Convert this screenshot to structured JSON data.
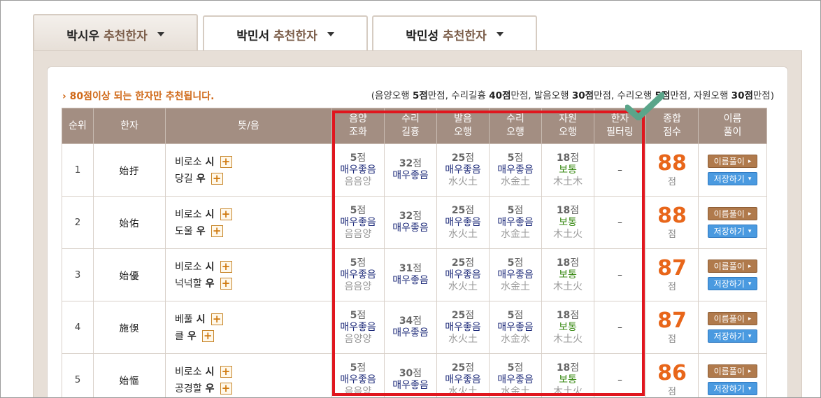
{
  "tabs": [
    {
      "name": "박시우",
      "label": "추천한자"
    },
    {
      "name": "박민서",
      "label": "추천한자"
    },
    {
      "name": "박민성",
      "label": "추천한자"
    }
  ],
  "notice": "› 80점이상 되는 한자만 추천됩니다.",
  "score_info": {
    "p0": "(음양오행 ",
    "b0": "5점",
    "p1": "만점, 수리길흉 ",
    "b1": "40점",
    "p2": "만점, 발음오행 ",
    "b2": "30점",
    "p3": "만점, 수리오행 ",
    "b3": "5점",
    "p4": "만점, 자원오행 ",
    "b4": "30점",
    "p5": "만점)"
  },
  "headers": {
    "rank": "순위",
    "hanja": "한자",
    "meaning": "뜻/음",
    "yinyang": [
      "음양",
      "조화"
    ],
    "suri_gh": [
      "수리",
      "길흉"
    ],
    "bareum": [
      "발음",
      "오행"
    ],
    "suri_oh": [
      "수리",
      "오행"
    ],
    "jawon": [
      "자원",
      "오행"
    ],
    "filter": [
      "한자",
      "필터링"
    ],
    "total": [
      "종합",
      "점수"
    ],
    "interp": [
      "이름",
      "풀이"
    ]
  },
  "buttons": {
    "interp": "이름풀이",
    "save": "저장하기"
  },
  "rows": [
    {
      "rank": "1",
      "hanja": "始扜",
      "m1": {
        "mean": "비로소",
        "sound": "시"
      },
      "m2": {
        "mean": "당길",
        "sound": "우"
      },
      "yy": {
        "num": "5",
        "unit": "점",
        "lvl": "매우좋음",
        "sub": "음음양"
      },
      "sg": {
        "num": "32",
        "unit": "점",
        "lvl": "매우좋음",
        "sub": ""
      },
      "br": {
        "num": "25",
        "unit": "점",
        "lvl": "매우좋음",
        "sub": "水火土"
      },
      "so": {
        "num": "5",
        "unit": "점",
        "lvl": "매우좋음",
        "sub": "水金土"
      },
      "jw": {
        "num": "18",
        "unit": "점",
        "lvl": "보통",
        "sub": "木土木"
      },
      "filter": "–",
      "total": "88",
      "total_unit": "점"
    },
    {
      "rank": "2",
      "hanja": "始佑",
      "m1": {
        "mean": "비로소",
        "sound": "시"
      },
      "m2": {
        "mean": "도울",
        "sound": "우"
      },
      "yy": {
        "num": "5",
        "unit": "점",
        "lvl": "매우좋음",
        "sub": "음음양"
      },
      "sg": {
        "num": "32",
        "unit": "점",
        "lvl": "매우좋음",
        "sub": ""
      },
      "br": {
        "num": "25",
        "unit": "점",
        "lvl": "매우좋음",
        "sub": "水火土"
      },
      "so": {
        "num": "5",
        "unit": "점",
        "lvl": "매우좋음",
        "sub": "水金土"
      },
      "jw": {
        "num": "18",
        "unit": "점",
        "lvl": "보통",
        "sub": "木土火"
      },
      "filter": "–",
      "total": "88",
      "total_unit": "점"
    },
    {
      "rank": "3",
      "hanja": "始優",
      "m1": {
        "mean": "비로소",
        "sound": "시"
      },
      "m2": {
        "mean": "넉넉할",
        "sound": "우"
      },
      "yy": {
        "num": "5",
        "unit": "점",
        "lvl": "매우좋음",
        "sub": "음음양"
      },
      "sg": {
        "num": "31",
        "unit": "점",
        "lvl": "매우좋음",
        "sub": ""
      },
      "br": {
        "num": "25",
        "unit": "점",
        "lvl": "매우좋음",
        "sub": "水火土"
      },
      "so": {
        "num": "5",
        "unit": "점",
        "lvl": "매우좋음",
        "sub": "水金土"
      },
      "jw": {
        "num": "18",
        "unit": "점",
        "lvl": "보통",
        "sub": "木土火"
      },
      "filter": "–",
      "total": "87",
      "total_unit": "점"
    },
    {
      "rank": "4",
      "hanja": "施俁",
      "m1": {
        "mean": "베풀",
        "sound": "시"
      },
      "m2": {
        "mean": "클",
        "sound": "우"
      },
      "yy": {
        "num": "5",
        "unit": "점",
        "lvl": "매우좋음",
        "sub": "음양양"
      },
      "sg": {
        "num": "34",
        "unit": "점",
        "lvl": "매우좋음",
        "sub": ""
      },
      "br": {
        "num": "25",
        "unit": "점",
        "lvl": "매우좋음",
        "sub": "水火土"
      },
      "so": {
        "num": "5",
        "unit": "점",
        "lvl": "매우좋음",
        "sub": "水金水"
      },
      "jw": {
        "num": "18",
        "unit": "점",
        "lvl": "보통",
        "sub": "木土火"
      },
      "filter": "–",
      "total": "87",
      "total_unit": "점"
    },
    {
      "rank": "5",
      "hanja": "始慪",
      "m1": {
        "mean": "비로소",
        "sound": "시"
      },
      "m2": {
        "mean": "공경할",
        "sound": "우"
      },
      "yy": {
        "num": "5",
        "unit": "점",
        "lvl": "매우좋음",
        "sub": "음음양"
      },
      "sg": {
        "num": "30",
        "unit": "점",
        "lvl": "매우좋음",
        "sub": ""
      },
      "br": {
        "num": "25",
        "unit": "점",
        "lvl": "매우좋음",
        "sub": "水火土"
      },
      "so": {
        "num": "5",
        "unit": "점",
        "lvl": "매우좋음",
        "sub": "水金土"
      },
      "jw": {
        "num": "18",
        "unit": "점",
        "lvl": "보통",
        "sub": "木土火"
      },
      "filter": "–",
      "total": "86",
      "total_unit": "점"
    }
  ],
  "colors": {
    "highlight": "#e0161e",
    "check": "#5aa58a",
    "total": "#e8661a",
    "header_bg": "#a38e82"
  }
}
